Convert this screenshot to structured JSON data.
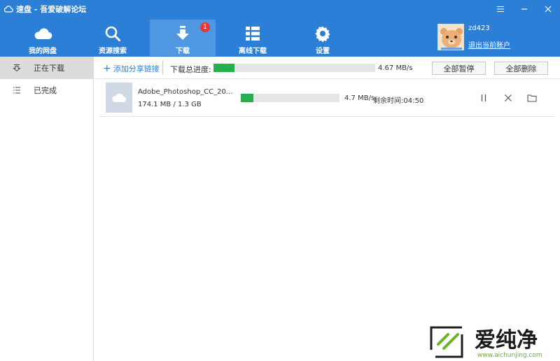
{
  "window": {
    "title": "速盘 - 吾爱破解论坛"
  },
  "nav": {
    "items": [
      {
        "label": "我的网盘",
        "icon": "cloud-icon"
      },
      {
        "label": "资源搜索",
        "icon": "search-icon"
      },
      {
        "label": "下载",
        "icon": "download-icon",
        "badge": "1"
      },
      {
        "label": "离线下载",
        "icon": "grid-icon"
      },
      {
        "label": "设置",
        "icon": "gear-icon"
      }
    ],
    "active_index": 2
  },
  "user": {
    "name": "zd423",
    "logout_label": "退出当前账户"
  },
  "sidebar": {
    "items": [
      {
        "label": "正在下载",
        "icon": "download-outline-icon"
      },
      {
        "label": "已完成",
        "icon": "list-icon"
      }
    ]
  },
  "toolbar": {
    "add_link_label": "添加分享链接",
    "total_progress_label": "下载总进度:",
    "total_progress_fraction": 0.13,
    "total_speed": "4.67 MB/s",
    "pause_all_label": "全部暂停",
    "delete_all_label": "全部删除"
  },
  "tasks": [
    {
      "file_name": "Adobe_Photoshop_CC_20...",
      "size_text": "174.1 MB / 1.3 GB",
      "progress_fraction": 0.13,
      "speed": "4.7 MB/s",
      "remaining": "剩余时间:04:50"
    }
  ],
  "watermark": {
    "brand": "爱纯净",
    "url": "www.aichunjing.com"
  },
  "colors": {
    "accent": "#2b7fd6",
    "progress": "#22b14c",
    "badge": "#e53935"
  }
}
